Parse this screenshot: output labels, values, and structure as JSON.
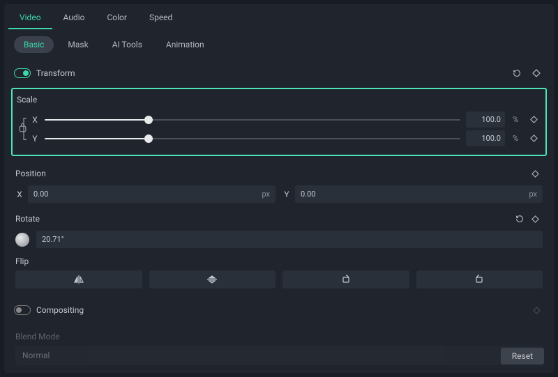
{
  "main_tabs": {
    "items": [
      "Video",
      "Audio",
      "Color",
      "Speed"
    ],
    "active": 0
  },
  "sub_tabs": {
    "items": [
      "Basic",
      "Mask",
      "AI Tools",
      "Animation"
    ],
    "active": 0
  },
  "transform": {
    "label": "Transform",
    "on": true
  },
  "scale": {
    "label": "Scale",
    "x": {
      "label": "X",
      "value": "100.0",
      "unit": "%",
      "percent": 25
    },
    "y": {
      "label": "Y",
      "value": "100.0",
      "unit": "%",
      "percent": 25
    }
  },
  "position": {
    "label": "Position",
    "x": {
      "label": "X",
      "value": "0.00",
      "unit": "px"
    },
    "y": {
      "label": "Y",
      "value": "0.00",
      "unit": "px"
    }
  },
  "rotate": {
    "label": "Rotate",
    "value": "20.71°"
  },
  "flip": {
    "label": "Flip"
  },
  "compositing": {
    "label": "Compositing",
    "on": false
  },
  "blend": {
    "label": "Blend Mode",
    "value": "Normal"
  },
  "reset": {
    "label": "Reset"
  }
}
